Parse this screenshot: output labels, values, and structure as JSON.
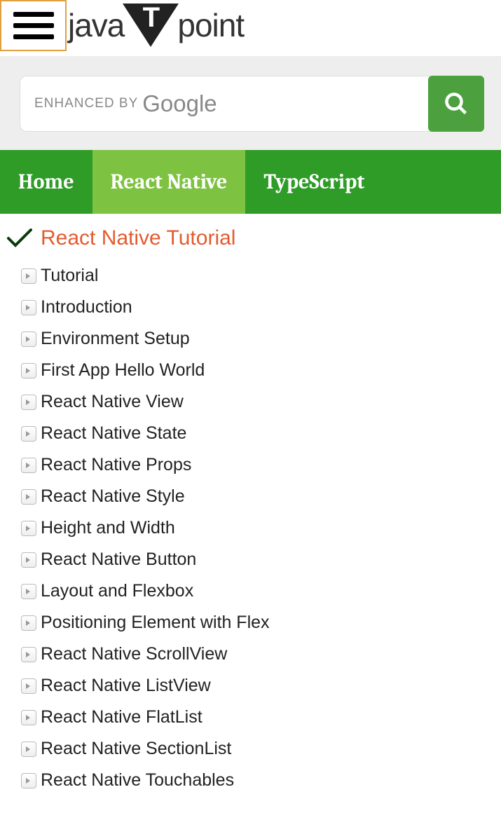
{
  "logo": {
    "left": "java",
    "right": "point"
  },
  "search": {
    "enhanced_text": "ENHANCED BY",
    "google_text": "Google"
  },
  "tabs": [
    {
      "label": "Home",
      "active": false
    },
    {
      "label": "React Native",
      "active": true
    },
    {
      "label": "TypeScript",
      "active": false
    }
  ],
  "section": {
    "title": "React Native Tutorial",
    "items": [
      "Tutorial",
      "Introduction",
      "Environment Setup",
      "First App Hello World",
      "React Native View",
      "React Native State",
      "React Native Props",
      "React Native Style",
      "Height and Width",
      "React Native Button",
      "Layout and Flexbox",
      "Positioning Element with Flex",
      "React Native ScrollView",
      "React Native ListView",
      "React Native FlatList",
      "React Native SectionList",
      "React Native Touchables"
    ]
  }
}
